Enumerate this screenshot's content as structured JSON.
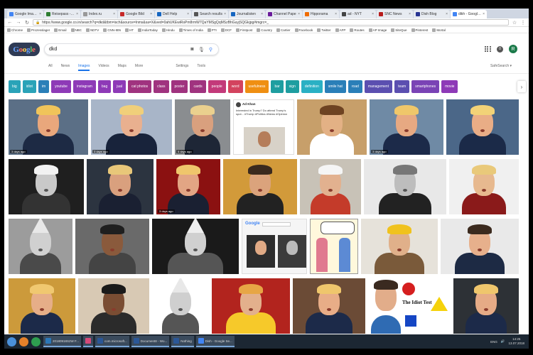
{
  "browser": {
    "tabs": [
      {
        "title": "Google Images",
        "color": "#4285f4",
        "active": false
      },
      {
        "title": "Reisepass - Ab...",
        "color": "#2e7d32",
        "active": false
      },
      {
        "title": "Index.ru",
        "color": "#999999",
        "active": false
      },
      {
        "title": "Google Bild",
        "color": "#c62828",
        "active": false
      },
      {
        "title": "Dell Help",
        "color": "#1565c0",
        "active": false
      },
      {
        "title": "Search results",
        "color": "#555555",
        "active": false
      },
      {
        "title": "Journalisten",
        "color": "#1565c0",
        "active": false
      },
      {
        "title": "Channel Pape",
        "color": "#6a1b9a",
        "active": false
      },
      {
        "title": "Hipporama",
        "color": "#ef6c00",
        "active": false
      },
      {
        "title": "ad - NYT",
        "color": "#444444",
        "active": false
      },
      {
        "title": "SNC News",
        "color": "#b71c1c",
        "active": false
      },
      {
        "title": "Dish Blog",
        "color": "#283593",
        "active": false
      },
      {
        "title": "dikh - Google Se",
        "color": "#4285f4",
        "active": true
      }
    ],
    "url": "https://www.google.co.in/search?q=dkd&tbm=isch&source=lnms&sa=X&ved=0ahUKEwiRsPm8rmW7QaYMSgQqMSzBhGuyjSQGkjpg#imgrc=_",
    "bookmarks": [
      "Chrome",
      "Prozesslager",
      "Email",
      "NBC",
      "NDTV",
      "CNN-IBN",
      "HT",
      "IndiaToday",
      "Hindu",
      "Times of India",
      "PTI",
      "DCF",
      "Firstpost",
      "Country",
      "Cartier",
      "Facebook",
      "Twitter",
      "AFP",
      "Routes",
      "AP Image",
      "SiteQue",
      "Pinterest",
      "Mortal"
    ]
  },
  "google": {
    "logo": "Google",
    "query": "dkd",
    "nav_tabs": [
      "All",
      "News",
      "Images",
      "Videos",
      "Maps",
      "More"
    ],
    "selected_tab": "Images",
    "settings": "Settings",
    "tools": "Tools",
    "safesearch": "SafeSearch ▾",
    "avatar_letter": "R",
    "chips": [
      {
        "label": "big",
        "color": "#2aa3b8"
      },
      {
        "label": "idiot",
        "color": "#2aa3b8"
      },
      {
        "label": "im",
        "color": "#2a7fb8"
      },
      {
        "label": "youtube",
        "color": "#8e3ab7"
      },
      {
        "label": "instagram",
        "color": "#8e3ab7"
      },
      {
        "label": "bag",
        "color": "#8e3ab7"
      },
      {
        "label": "jual",
        "color": "#8e3ab7"
      },
      {
        "label": "cat photos",
        "color": "#a0337f"
      },
      {
        "label": "class",
        "color": "#a0337f"
      },
      {
        "label": "poster",
        "color": "#a0337f"
      },
      {
        "label": "cards",
        "color": "#a0337f"
      },
      {
        "label": "people",
        "color": "#c33a7a"
      },
      {
        "label": "word",
        "color": "#d3435e"
      },
      {
        "label": "usefulness",
        "color": "#ef8f12"
      },
      {
        "label": "bar",
        "color": "#1e9ea0"
      },
      {
        "label": "sign",
        "color": "#1e9ea0"
      },
      {
        "label": "definition",
        "color": "#2ab0c4"
      },
      {
        "label": "smile hat",
        "color": "#2a7fb8"
      },
      {
        "label": "road",
        "color": "#2a7fb8"
      },
      {
        "label": "management",
        "color": "#5b4fb0"
      },
      {
        "label": "team",
        "color": "#5b4fb0"
      },
      {
        "label": "smartphones",
        "color": "#7a43b5"
      },
      {
        "label": "movie",
        "color": "#8e3ab7"
      }
    ],
    "age_label": "3 days ago",
    "age_label_alt": "5 days ago",
    "snippet_title": "Ad Khan",
    "snippet_text": "Interested in Trump? Do attend Trump's spot... #Trump #Politics #News #Opinion",
    "idiot_test": "The Idiot Test",
    "search_card_logo": "Google"
  },
  "taskbar": {
    "items": [
      {
        "label": "20180918S2W F...",
        "color": "#2c78b8"
      },
      {
        "label": "",
        "color": "#d64a7a"
      },
      {
        "label": "com.microsoft...",
        "color": "#2b5797"
      },
      {
        "label": "Document8 - Wo...",
        "color": "#2b5797"
      },
      {
        "label": "Nothing",
        "color": "#2b5797"
      },
      {
        "label": "Dish - Google Se...",
        "color": "#4285f4"
      }
    ],
    "lang": "ENG",
    "time": "14:25",
    "date": "13.07.2018"
  }
}
